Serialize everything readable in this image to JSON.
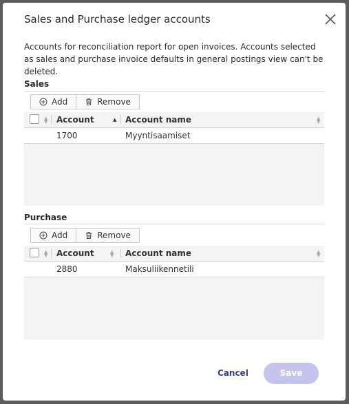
{
  "dialog": {
    "title": "Sales and Purchase ledger accounts",
    "description": "Accounts for reconciliation report for open invoices. Accounts selected as sales and purchase invoice defaults in general postings view can't be deleted."
  },
  "sales": {
    "label": "Sales",
    "add_label": "Add",
    "remove_label": "Remove",
    "columns": {
      "account": "Account",
      "account_name": "Account name"
    },
    "rows": [
      {
        "account": "1700",
        "account_name": "Myyntisaamiset"
      }
    ]
  },
  "purchase": {
    "label": "Purchase",
    "add_label": "Add",
    "remove_label": "Remove",
    "columns": {
      "account": "Account",
      "account_name": "Account name"
    },
    "rows": [
      {
        "account": "2880",
        "account_name": "Maksuliikennetili"
      }
    ]
  },
  "footer": {
    "cancel_label": "Cancel",
    "save_label": "Save"
  },
  "colors": {
    "accent": "#3a3a8a",
    "save_disabled": "#c5c4ec",
    "overlay": "#5c5c5c"
  },
  "icons": {
    "close": "close-icon",
    "add": "plus-circle-icon",
    "remove": "trash-icon"
  }
}
